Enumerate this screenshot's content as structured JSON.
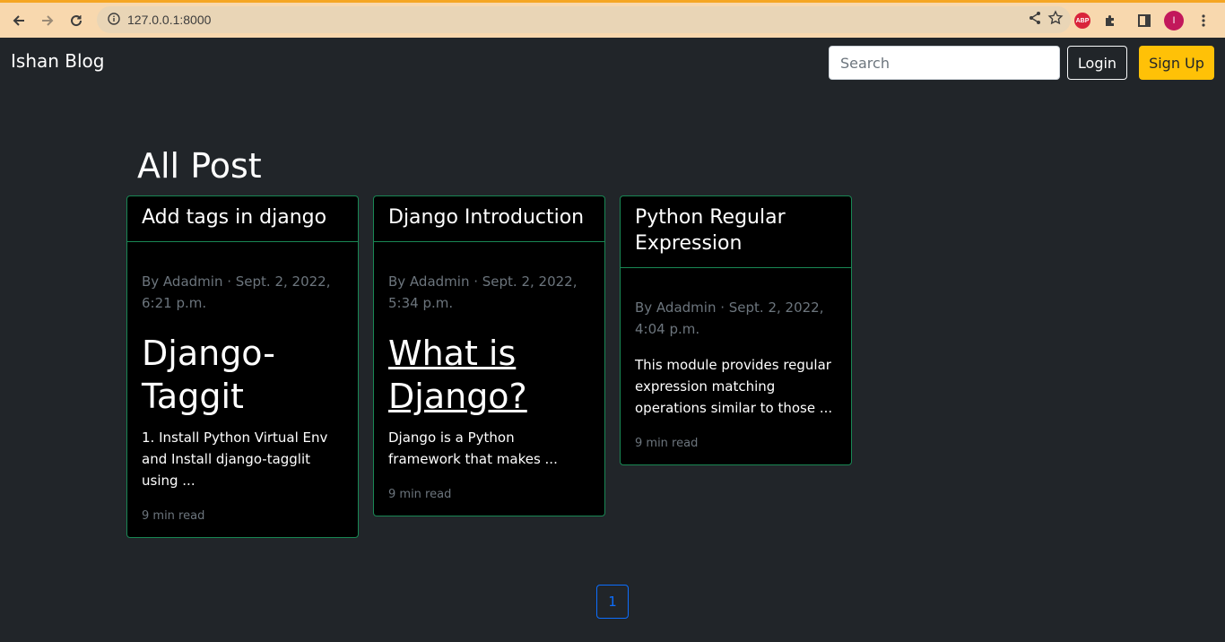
{
  "browser": {
    "url": "127.0.0.1:8000",
    "abp_label": "ABP",
    "avatar_letter": "I"
  },
  "navbar": {
    "brand": "Ishan Blog",
    "search_placeholder": "Search",
    "login_label": "Login",
    "signup_label": "Sign Up"
  },
  "main": {
    "title": "All Post",
    "posts": [
      {
        "title": "Add tags in django",
        "meta": "By Adadmin · Sept. 2, 2022, 6:21 p.m.",
        "heading": "Django-Taggit",
        "excerpt": "1. Install Python Virtual Env and Install django-tagglit using ...",
        "read_time": "9 min read"
      },
      {
        "title": "Django Introduction",
        "meta": "By Adadmin · Sept. 2, 2022, 5:34 p.m.",
        "heading": "What is Django?",
        "excerpt": "Django is a Python framework that makes ...",
        "read_time": "9 min read"
      },
      {
        "title": "Python Regular Expression",
        "meta": "By Adadmin · Sept. 2, 2022, 4:04 p.m.",
        "excerpt": "This module provides regular expression matching operations similar to those ...",
        "read_time": "9 min read"
      }
    ],
    "pagination": {
      "current": "1"
    }
  },
  "colors": {
    "page_bg": "#212529",
    "card_bg": "#000000",
    "card_border": "#198754",
    "signup_bg": "#ffc107",
    "pager_accent": "#0d6efd",
    "chrome_bg": "#f8d8ae"
  }
}
